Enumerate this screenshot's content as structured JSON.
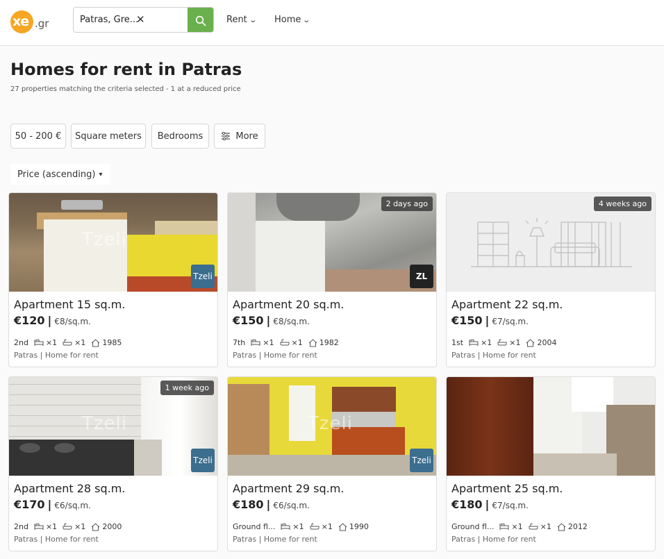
{
  "header": {
    "logo_main": "xe",
    "logo_suffix": ".gr",
    "search_value": "Patras, Gre...",
    "nav": [
      {
        "label": "Rent"
      },
      {
        "label": "Home"
      }
    ]
  },
  "page": {
    "title": "Homes for rent in Patras",
    "subtitle": "27 properties matching the criteria selected - 1 at a reduced price"
  },
  "filters": [
    {
      "label": "50 - 200 €"
    },
    {
      "label": "Square meters"
    },
    {
      "label": "Bedrooms"
    },
    {
      "label": "More"
    }
  ],
  "sort": {
    "label": "Price (ascending)"
  },
  "listings": [
    {
      "title": "Apartment 15 sq.m.",
      "price": "€120",
      "per_sqm": "€8/sq.m.",
      "floor": "2nd",
      "bedrooms": "×1",
      "bathrooms": "×1",
      "year": "1985",
      "location": "Patras | Home for rent",
      "badge": "",
      "agent": "Tzeli",
      "watermark": "Tzeli"
    },
    {
      "title": "Apartment 20 sq.m.",
      "price": "€150",
      "per_sqm": "€8/sq.m.",
      "floor": "7th",
      "bedrooms": "×1",
      "bathrooms": "×1",
      "year": "1982",
      "location": "Patras | Home for rent",
      "badge": "2 days ago",
      "agent": "ZL",
      "watermark": ""
    },
    {
      "title": "Apartment 22 sq.m.",
      "price": "€150",
      "per_sqm": "€7/sq.m.",
      "floor": "1st",
      "bedrooms": "×1",
      "bathrooms": "×1",
      "year": "2004",
      "location": "Patras | Home for rent",
      "badge": "4 weeks ago",
      "agent": "",
      "watermark": ""
    },
    {
      "title": "Apartment 28 sq.m.",
      "price": "€170",
      "per_sqm": "€6/sq.m.",
      "floor": "2nd",
      "bedrooms": "×1",
      "bathrooms": "×1",
      "year": "2000",
      "location": "Patras | Home for rent",
      "badge": "1 week ago",
      "agent": "Tzeli",
      "watermark": "Tzeli"
    },
    {
      "title": "Apartment 29 sq.m.",
      "price": "€180",
      "per_sqm": "€6/sq.m.",
      "floor": "Ground fl...",
      "bedrooms": "×1",
      "bathrooms": "×1",
      "year": "1990",
      "location": "Patras | Home for rent",
      "badge": "",
      "agent": "Tzeli",
      "watermark": "Tzeli"
    },
    {
      "title": "Apartment 25 sq.m.",
      "price": "€180",
      "per_sqm": "€7/sq.m.",
      "floor": "Ground fl...",
      "bedrooms": "×1",
      "bathrooms": "×1",
      "year": "2012",
      "location": "Patras | Home for rent",
      "badge": "",
      "agent": "",
      "watermark": ""
    }
  ],
  "colors": {
    "brand_orange": "#f5a623",
    "search_green": "#6ab04c",
    "agent_tzeli": "#3b6e8f"
  }
}
